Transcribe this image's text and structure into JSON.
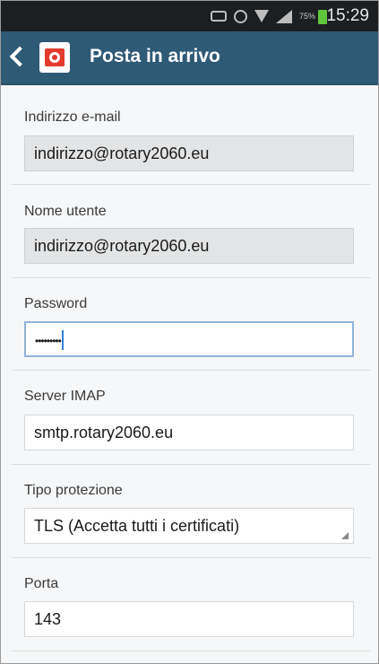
{
  "status_bar": {
    "battery_percent": "75%",
    "time": "15:29",
    "icons": [
      "nfc-icon",
      "alarm-icon",
      "wifi-icon",
      "signal-icon",
      "battery-icon"
    ]
  },
  "action_bar": {
    "title": "Posta in arrivo",
    "back_icon": "chevron-left-icon",
    "app_icon": "email-app-icon"
  },
  "form": {
    "email": {
      "label": "Indirizzo e-mail",
      "value": "indirizzo@rotary2060.eu"
    },
    "username": {
      "label": "Nome utente",
      "value": "indirizzo@rotary2060.eu"
    },
    "password": {
      "label": "Password",
      "value": "•••••••••"
    },
    "server": {
      "label": "Server IMAP",
      "value": "smtp.rotary2060.eu"
    },
    "security": {
      "label": "Tipo protezione",
      "value": "TLS (Accetta tutti i certificati)"
    },
    "port": {
      "label": "Porta",
      "value": "143"
    }
  },
  "colors": {
    "action_bar": "#2f5a76",
    "status_bar": "#1c1f22",
    "focus_border": "#8fb4d8",
    "battery": "#5fc73c"
  }
}
